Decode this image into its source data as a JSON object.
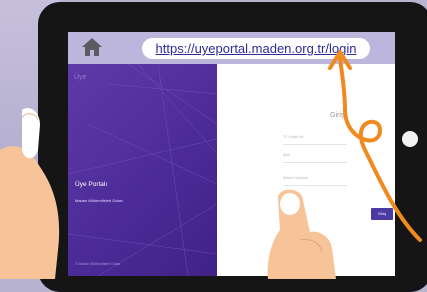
{
  "browser": {
    "url": "https://uyeportal.maden.org.tr/login",
    "home_icon": "home-icon"
  },
  "login_page": {
    "brand": "Üye",
    "portal_title": "Üye Portalı",
    "portal_subtitle": "Maden Mühendisleri Odası",
    "left_footer": "© Maden Mühendisleri Odası",
    "login_title": "Giriş",
    "username_placeholder": "TC Kimlik No",
    "password_placeholder": "Şifre",
    "forgot_link": "Şifremi Unuttum",
    "login_button": "Giriş"
  },
  "colors": {
    "panel_purple": "#4c2b98",
    "urlbar_lavender": "#bdb6dc",
    "url_text": "#2d2a9a",
    "arrow_orange": "#f08a1f"
  },
  "illustration": {
    "hands": "left-hand-holding-tablet, right-hand-pointing",
    "arrow": "orange-curly-arrow-to-url"
  }
}
